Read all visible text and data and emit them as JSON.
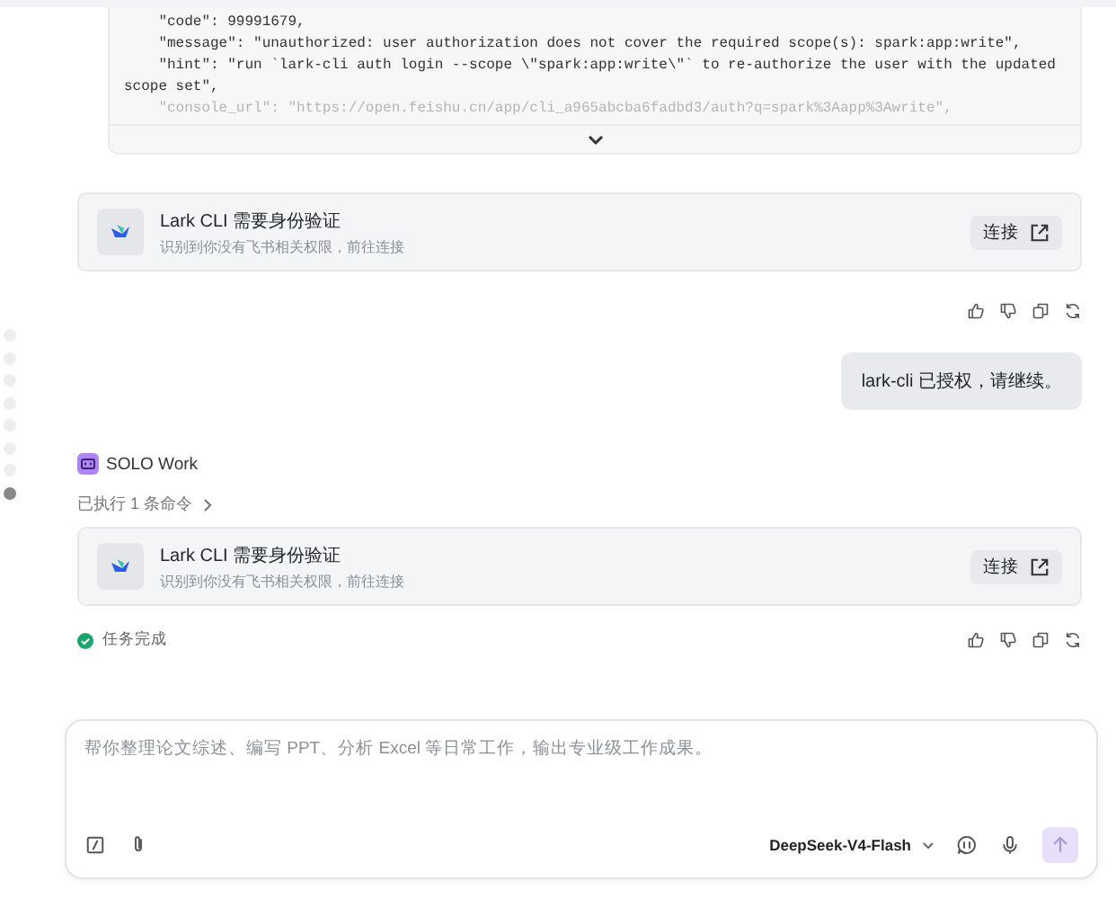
{
  "code_block": {
    "lines": [
      "    \"code\": 99991679,",
      "    \"message\": \"unauthorized: user authorization does not cover the required scope(s): spark:app:write\",",
      "    \"hint\": \"run `lark-cli auth login --scope \\\"spark:app:write\\\"` to re-authorize the user with the updated scope set\",",
      "    \"console_url\": \"https://open.feishu.cn/app/cli_a965abcba6fadbd3/auth?q=spark%3Aapp%3Awrite\","
    ],
    "expanded": false
  },
  "timeline": [
    {
      "selected": false
    },
    {
      "selected": false
    },
    {
      "selected": false
    },
    {
      "selected": false
    },
    {
      "selected": false
    },
    {
      "selected": false
    },
    {
      "selected": false
    },
    {
      "selected": true
    }
  ],
  "auth_card_1": {
    "title": "Lark CLI 需要身份验证",
    "subtitle": "识别到你没有飞书相关权限，前往连接",
    "button": "连接"
  },
  "user_message": "lark-cli 已授权，请继续。",
  "agent": {
    "name": "SOLO Work",
    "commands": "已执行 1 条命令"
  },
  "auth_card_2": {
    "title": "Lark CLI 需要身份验证",
    "subtitle": "识别到你没有飞书相关权限，前往连接",
    "button": "连接"
  },
  "status": "任务完成",
  "composer": {
    "placeholder": "帮你整理论文综述、编写 PPT、分析 Excel 等日常工作，输出专业级工作成果。",
    "model": "DeepSeek-V4-Flash"
  }
}
